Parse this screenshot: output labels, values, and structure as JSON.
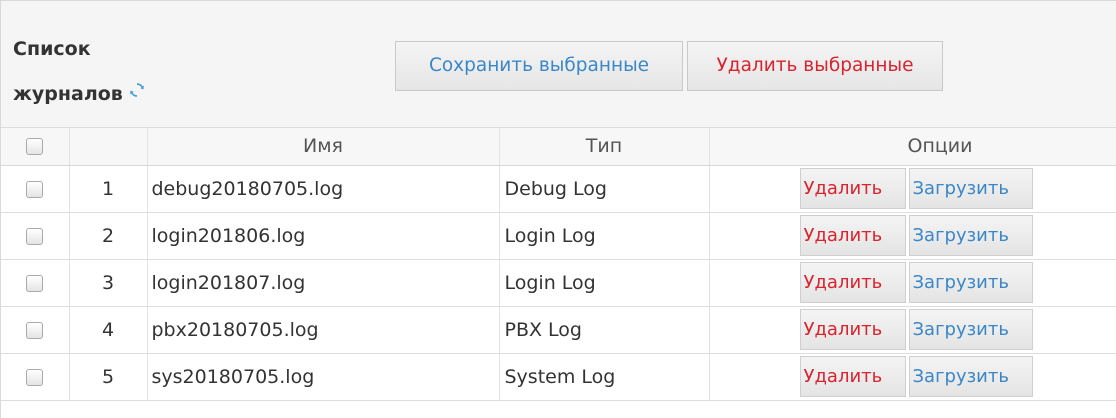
{
  "header": {
    "title_line1": "Список",
    "title_line2": "журналов",
    "refresh_icon": "refresh-icon",
    "save_selected_label": "Сохранить выбранные",
    "delete_selected_label": "Удалить выбранные"
  },
  "table": {
    "columns": {
      "name": "Имя",
      "type": "Тип",
      "options": "Опции"
    },
    "rows": [
      {
        "num": "1",
        "name": "debug20180705.log",
        "type": "Debug Log",
        "delete_label": "Удалить",
        "download_label": "Загрузить"
      },
      {
        "num": "2",
        "name": "login201806.log",
        "type": "Login Log",
        "delete_label": "Удалить",
        "download_label": "Загрузить"
      },
      {
        "num": "3",
        "name": "login201807.log",
        "type": "Login Log",
        "delete_label": "Удалить",
        "download_label": "Загрузить"
      },
      {
        "num": "4",
        "name": "pbx20180705.log",
        "type": "PBX Log",
        "delete_label": "Удалить",
        "download_label": "Загрузить"
      },
      {
        "num": "5",
        "name": "sys20180705.log",
        "type": "System Log",
        "delete_label": "Удалить",
        "download_label": "Загрузить"
      }
    ]
  },
  "colors": {
    "accent_blue": "#3a87c8",
    "danger_red": "#d9232e"
  }
}
